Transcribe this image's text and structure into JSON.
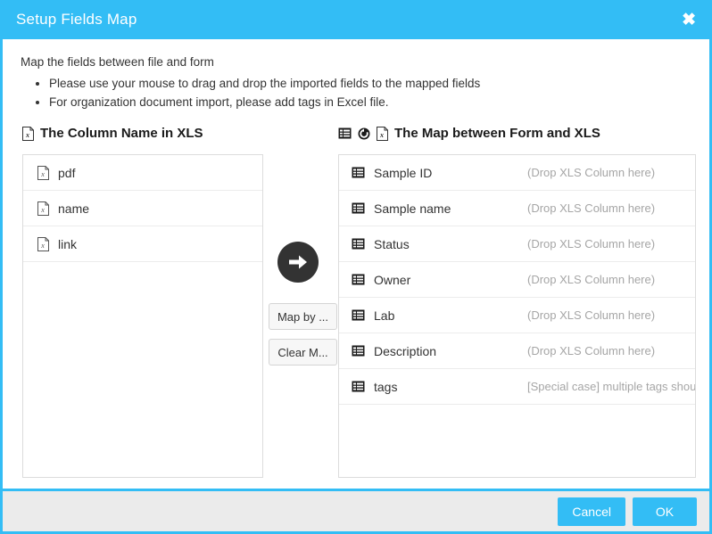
{
  "dialog": {
    "title": "Setup Fields Map",
    "close_label": "✖"
  },
  "instructions": {
    "intro": "Map the fields between file and form",
    "bullets": [
      "Please use your mouse to drag and drop the imported fields to the mapped fields",
      "For organization document import, please add tags in Excel file."
    ]
  },
  "left_panel": {
    "title": "The Column Name in XLS",
    "title_icon": "xls-file-icon",
    "items": [
      {
        "icon": "xls-file-icon",
        "label": "pdf"
      },
      {
        "icon": "xls-file-icon",
        "label": "name"
      },
      {
        "icon": "xls-file-icon",
        "label": "link"
      }
    ]
  },
  "middle": {
    "arrow_icon": "arrow-right-circle-icon",
    "map_by_label": "Map by ...",
    "clear_map_label": "Clear M..."
  },
  "right_panel": {
    "title": "The Map between Form and XLS",
    "title_icons": [
      "list-icon",
      "refresh-icon",
      "xls-file-icon"
    ],
    "rows": [
      {
        "icon": "list-icon",
        "label": "Sample ID",
        "value": "(Drop XLS Column here)"
      },
      {
        "icon": "list-icon",
        "label": "Sample name",
        "value": "(Drop XLS Column here)"
      },
      {
        "icon": "list-icon",
        "label": "Status",
        "value": "(Drop XLS Column here)"
      },
      {
        "icon": "list-icon",
        "label": "Owner",
        "value": "(Drop XLS Column here)"
      },
      {
        "icon": "list-icon",
        "label": "Lab",
        "value": "(Drop XLS Column here)"
      },
      {
        "icon": "list-icon",
        "label": "Description",
        "value": "(Drop XLS Column here)"
      },
      {
        "icon": "list-icon",
        "label": "tags",
        "value": "[Special case] multiple tags shou"
      }
    ]
  },
  "footer": {
    "cancel_label": "Cancel",
    "ok_label": "OK"
  },
  "colors": {
    "accent": "#33bdf5",
    "footer_bg": "#ebebeb",
    "arrow_circle": "#333333",
    "hint_text": "#a6a6a6"
  }
}
